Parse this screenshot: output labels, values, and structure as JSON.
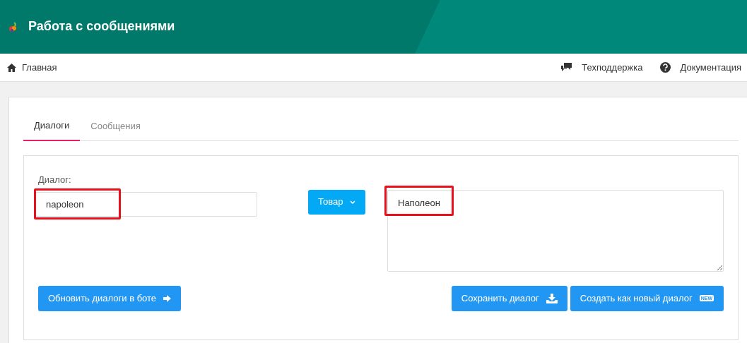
{
  "header": {
    "title": "Работа с сообщениями"
  },
  "topnav": {
    "home": "Главная",
    "links": [
      {
        "kind": "support",
        "label": "Техподдержка"
      },
      {
        "kind": "help",
        "label": "Документация"
      }
    ]
  },
  "tabs": [
    {
      "label": "Диалоги",
      "selected": true
    },
    {
      "label": "Сообщения",
      "selected": false
    }
  ],
  "form": {
    "dialog_label": "Диалог:",
    "dialog_value": "napoleon",
    "dialog_highlighted": true,
    "dropdown": "Товар",
    "text_value": "Наполеон",
    "text_highlighted": true
  },
  "buttons": [
    {
      "kind": "arrow",
      "label": "Обновить диалоги в боте"
    },
    {
      "kind": "download",
      "label": "Сохранить диалог"
    },
    {
      "kind": "new",
      "label": "Создать как новый диалог",
      "badge": "NEW"
    }
  ]
}
